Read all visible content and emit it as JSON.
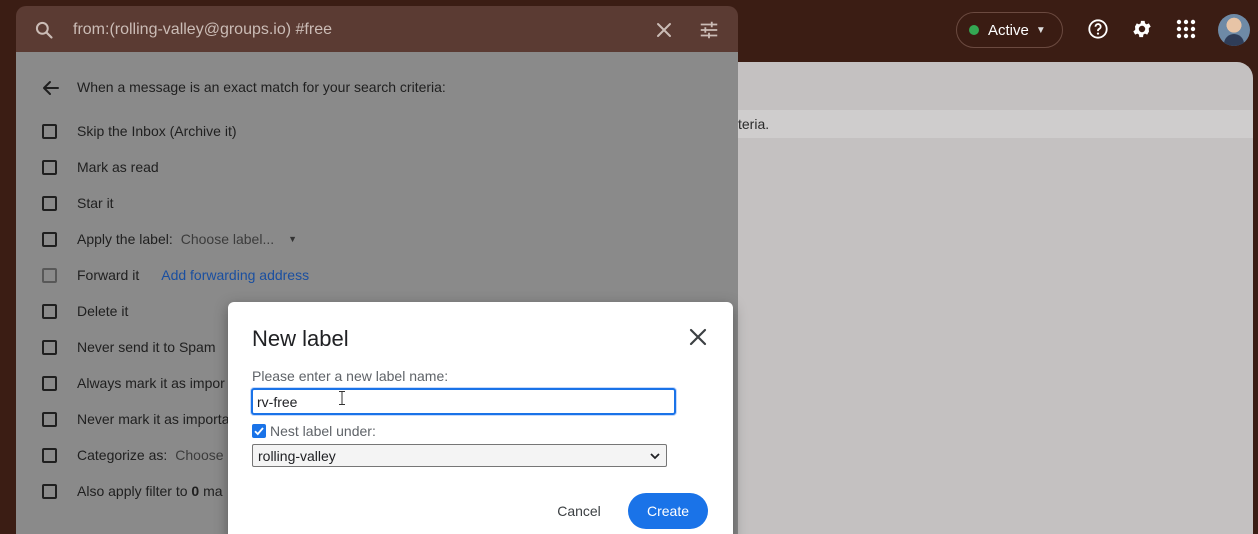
{
  "search": {
    "query": "from:(rolling-valley@groups.io) #free",
    "clear_icon": "close-icon",
    "options_icon": "tune-icon"
  },
  "header": {
    "status_label": "Active",
    "status_color": "#34a853",
    "icons": [
      "help-icon",
      "settings-icon",
      "apps-icon",
      "avatar"
    ]
  },
  "background": {
    "criteria_fragment": "teria."
  },
  "filter": {
    "heading": "When a message is an exact match for your search criteria:",
    "options": [
      {
        "label": "Skip the Inbox (Archive it)"
      },
      {
        "label": "Mark as read"
      },
      {
        "label": "Star it"
      },
      {
        "label": "Apply the label:",
        "select": "Choose label..."
      },
      {
        "label": "Forward it",
        "link": "Add forwarding address"
      },
      {
        "label": "Delete it"
      },
      {
        "label": "Never send it to Spam"
      },
      {
        "label": "Always mark it as impor"
      },
      {
        "label": "Never mark it as importa"
      },
      {
        "label": "Categorize as:",
        "select": "Choose"
      },
      {
        "label_prefix": "Also apply filter to ",
        "label_bold": "0",
        "label_suffix": " ma"
      }
    ]
  },
  "dialog": {
    "title": "New label",
    "prompt": "Please enter a new label name:",
    "label_name": "rv-free",
    "nest_checked": true,
    "nest_label": "Nest label under:",
    "nest_parent": "rolling-valley",
    "cancel_label": "Cancel",
    "create_label": "Create",
    "accent_color": "#1a73e8"
  }
}
